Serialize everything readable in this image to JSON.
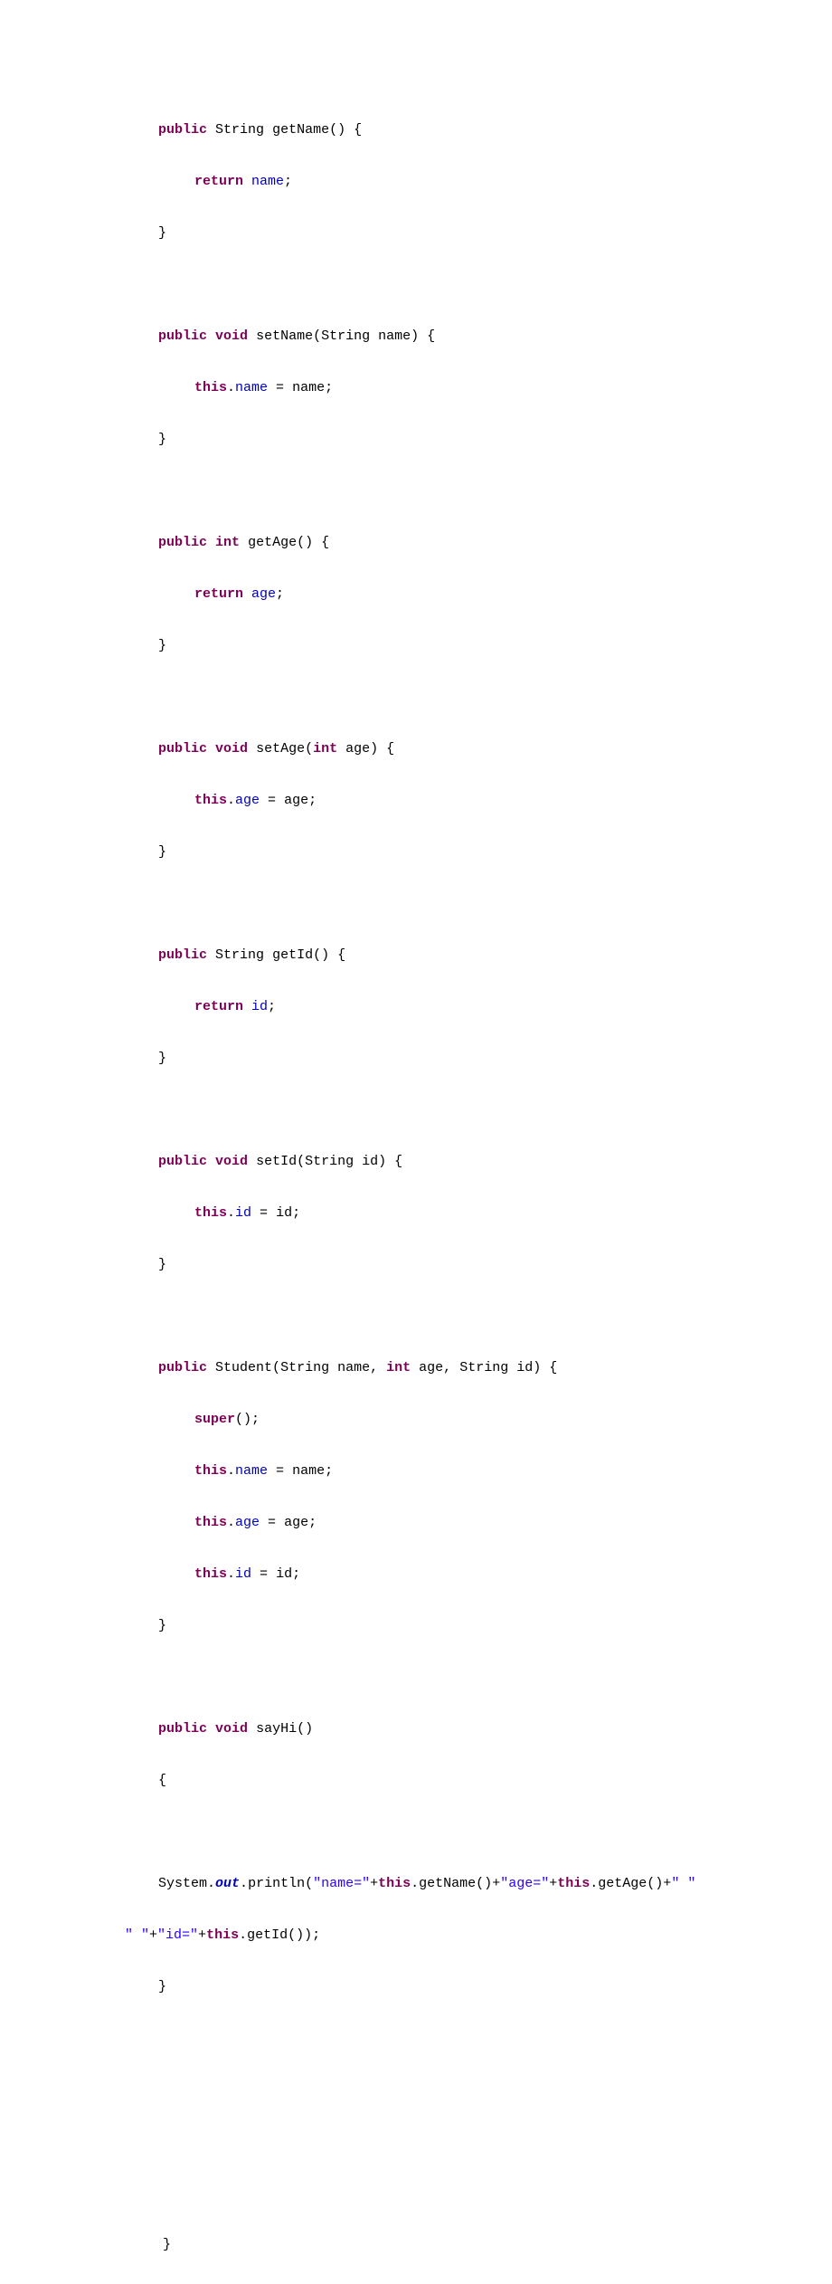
{
  "code": {
    "kw_public": "public",
    "kw_void": "void",
    "kw_int": "int",
    "kw_return": "return",
    "kw_this": "this",
    "kw_super": "super",
    "type_string": "String",
    "m_getName": "getName",
    "m_setName": "setName",
    "m_getAge": "getAge",
    "m_setAge": "setAge",
    "m_getId": "getId",
    "m_setId": "setId",
    "m_sayHi": "sayHi",
    "c_Student": "Student",
    "f_name": "name",
    "f_age": "age",
    "f_id": "id",
    "p_name": "name",
    "p_age": "age",
    "p_id": "id",
    "lbrace": "{",
    "rbrace": "}",
    "lparen": "(",
    "rparen": ")",
    "semi": ";",
    "eq": " = ",
    "dot": ".",
    "comma": ", ",
    "sys": "System",
    "out": "out",
    "println": "println",
    "s_name": "\"name=\"",
    "s_age": "\"age=\"",
    "s_sp": "\" \"",
    "s_id": "\"id=\"",
    "plus": "+",
    "empty_parens": "()",
    "empty_parens_semi": "();"
  }
}
